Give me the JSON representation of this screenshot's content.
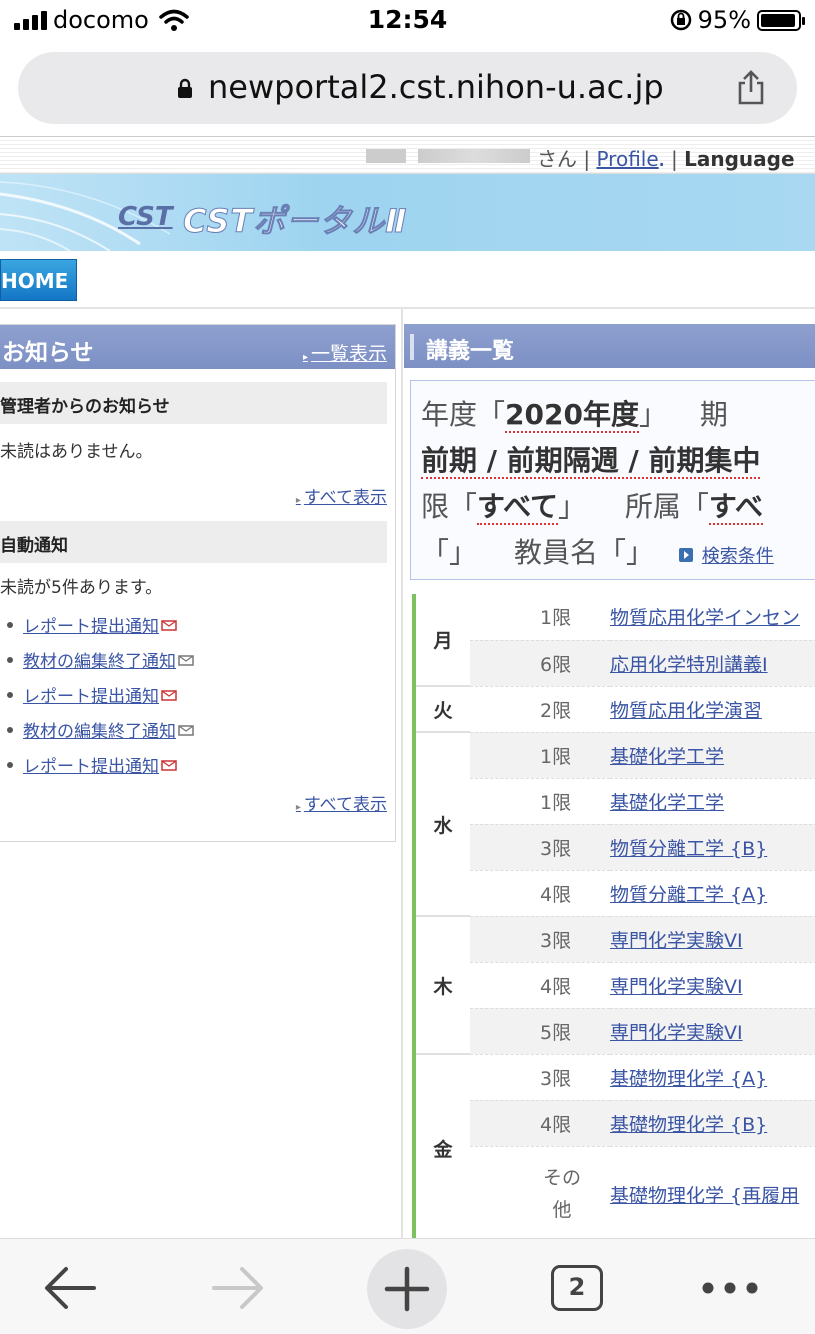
{
  "status_bar": {
    "carrier": "docomo",
    "time": "12:54",
    "battery": "95%",
    "battery_level": 0.95
  },
  "browser": {
    "url": "newportal2.cst.nihon-u.ac.jp",
    "tab_count": "2"
  },
  "userbar": {
    "san": "さん",
    "separator": "|",
    "profile": "Profile",
    "language": "Language"
  },
  "banner": {
    "logo_cst": "CST",
    "title": "CSTポータルⅡ"
  },
  "nav": {
    "home": "HOME"
  },
  "notices": {
    "title": "お知らせ",
    "list_link": "一覧表示",
    "admin_heading": "管理者からのお知らせ",
    "admin_status": "未読はありません。",
    "show_all": "すべて表示",
    "auto_heading": "自動通知",
    "auto_status": "未読が5件あります。",
    "items": [
      "レポート提出通知",
      "教材の編集終了通知",
      "レポート提出通知",
      "教材の編集終了通知",
      "レポート提出通知"
    ],
    "show_all_2": "すべて表示"
  },
  "courses": {
    "title": "講義一覧",
    "search": {
      "year_label": "年度",
      "year_value": "2020年度",
      "term_label": "期",
      "term_value": "前期 / 前期隔週 / 前期集中",
      "period_label": "限",
      "period_value": "すべて",
      "affil_label": "所属",
      "affil_value": "すべ",
      "blank_value": "",
      "teacher_label": "教員名",
      "teacher_value": "",
      "open_bracket": "「",
      "close_bracket": "」",
      "cond_link": "検索条件"
    },
    "rows": [
      {
        "day": "月",
        "period": "1限",
        "course": "物質応用化学インセン"
      },
      {
        "day": "",
        "period": "6限",
        "course": "応用化学特別講義Ⅰ"
      },
      {
        "day": "火",
        "period": "2限",
        "course": "物質応用化学演習"
      },
      {
        "day": "",
        "period": "1限",
        "course": "基礎化学工学"
      },
      {
        "day": "水",
        "period": "1限",
        "course": "基礎化学工学"
      },
      {
        "day": "",
        "period": "3限",
        "course": "物質分離工学 {B}"
      },
      {
        "day": "",
        "period": "4限",
        "course": "物質分離工学 {A}"
      },
      {
        "day": "",
        "period": "3限",
        "course": "専門化学実験VI"
      },
      {
        "day": "木",
        "period": "4限",
        "course": "専門化学実験VI"
      },
      {
        "day": "",
        "period": "5限",
        "course": "専門化学実験VI"
      },
      {
        "day": "",
        "period": "3限",
        "course": "基礎物理化学 {A}"
      },
      {
        "day": "",
        "period": "4限",
        "course": "基礎物理化学 {B}"
      },
      {
        "day": "金",
        "period": "その他",
        "course": "基礎物理化学 {再履用"
      }
    ]
  }
}
